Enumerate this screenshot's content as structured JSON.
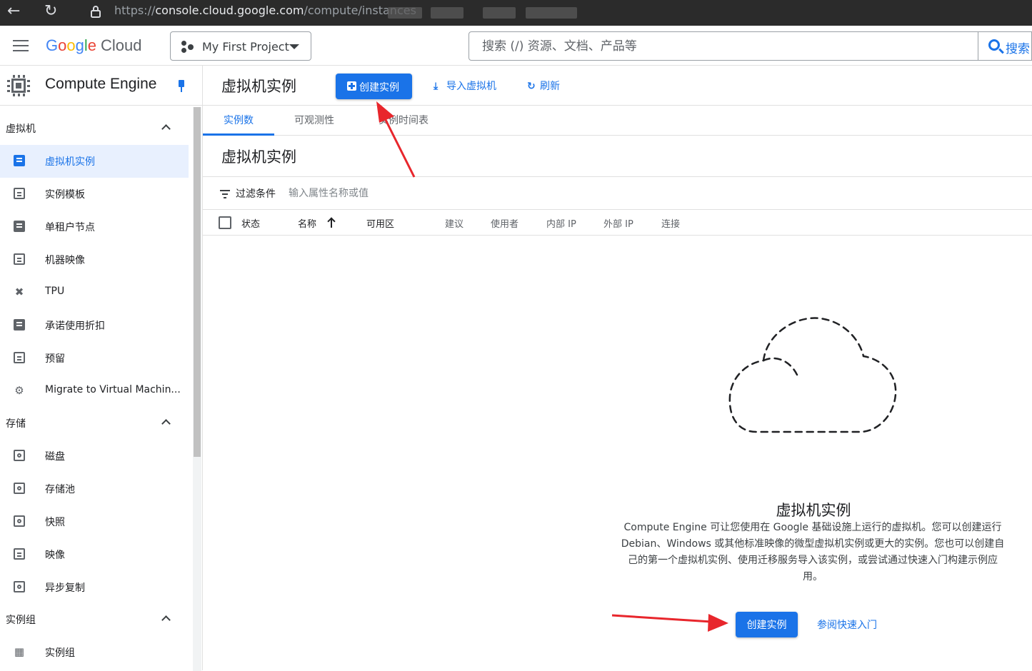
{
  "browser": {
    "url_scheme": "https://",
    "url_host": "console.cloud.google.com",
    "url_path": "/compute/instances"
  },
  "header": {
    "logo": {
      "g": "G",
      "o1": "o",
      "o2": "o",
      "g2": "g",
      "l": "l",
      "e": "e",
      "product": "Cloud"
    },
    "project": "My First Project",
    "search_placeholder": "搜索 (/) 资源、文档、产品等",
    "search_button": "搜索"
  },
  "sidebar": {
    "title": "Compute Engine",
    "sections": [
      {
        "label": "虚拟机",
        "items": [
          {
            "label": "虚拟机实例",
            "icon": "vm-instance-icon",
            "active": true
          },
          {
            "label": "实例模板",
            "icon": "template-icon"
          },
          {
            "label": "单租户节点",
            "icon": "sole-tenant-icon"
          },
          {
            "label": "机器映像",
            "icon": "machine-image-icon"
          },
          {
            "label": "TPU",
            "icon": "tpu-icon"
          },
          {
            "label": "承诺使用折扣",
            "icon": "discount-icon"
          },
          {
            "label": "预留",
            "icon": "calendar-icon"
          },
          {
            "label": "Migrate to Virtual Machin...",
            "icon": "migrate-icon"
          }
        ]
      },
      {
        "label": "存储",
        "items": [
          {
            "label": "磁盘",
            "icon": "disk-icon"
          },
          {
            "label": "存储池",
            "icon": "storage-pool-icon"
          },
          {
            "label": "快照",
            "icon": "snapshot-icon"
          },
          {
            "label": "映像",
            "icon": "image-icon"
          },
          {
            "label": "异步复制",
            "icon": "async-replication-icon"
          }
        ]
      },
      {
        "label": "实例组",
        "items": [
          {
            "label": "实例组",
            "icon": "instance-group-icon"
          }
        ]
      }
    ]
  },
  "main": {
    "title": "虚拟机实例",
    "toolbar": {
      "create": "创建实例",
      "import": "导入虚拟机",
      "refresh": "刷新"
    },
    "tabs": [
      "实例数",
      "可观测性",
      "实例时间表"
    ],
    "section_title": "虚拟机实例",
    "filter": {
      "label": "过滤条件",
      "placeholder": "输入属性名称或值"
    },
    "columns": [
      "状态",
      "名称",
      "可用区",
      "建议",
      "使用者",
      "内部 IP",
      "外部 IP",
      "连接"
    ],
    "empty": {
      "title": "虚拟机实例",
      "description": "Compute Engine 可让您使用在 Google 基础设施上运行的虚拟机。您可以创建运行 Debian、Windows 或其他标准映像的微型虚拟机实例或更大的实例。您也可以创建自己的第一个虚拟机实例、使用迁移服务导入该实例，或尝试通过快速入门构建示例应用。",
      "create_button": "创建实例",
      "quickstart_link": "参阅快速入门"
    }
  },
  "colors": {
    "accent": "#1a73e8",
    "annotation_arrow": "#e8262c",
    "active_nav_bg": "#e8f0fe"
  }
}
